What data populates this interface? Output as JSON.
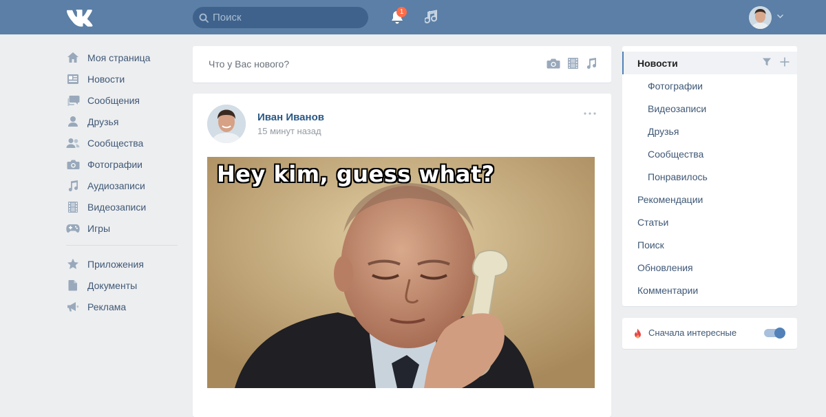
{
  "header": {
    "logo": "vk-logo-icon",
    "search_placeholder": "Поиск",
    "notifications_count": "1",
    "colors": {
      "bar": "#5b7fa6",
      "search": "#3f628c",
      "badge": "#ff6c48"
    }
  },
  "leftnav": {
    "items": [
      {
        "label": "Моя страница",
        "icon": "home-icon"
      },
      {
        "label": "Новости",
        "icon": "news-icon"
      },
      {
        "label": "Сообщения",
        "icon": "messages-icon"
      },
      {
        "label": "Друзья",
        "icon": "friend-icon"
      },
      {
        "label": "Сообщества",
        "icon": "communities-icon"
      },
      {
        "label": "Фотографии",
        "icon": "camera-icon"
      },
      {
        "label": "Аудиозаписи",
        "icon": "music-note-icon"
      },
      {
        "label": "Видеозаписи",
        "icon": "film-icon"
      },
      {
        "label": "Игры",
        "icon": "gamepad-icon"
      }
    ],
    "secondary": [
      {
        "label": "Приложения",
        "icon": "star-icon"
      },
      {
        "label": "Документы",
        "icon": "document-icon"
      },
      {
        "label": "Реклама",
        "icon": "megaphone-icon"
      }
    ]
  },
  "composer": {
    "placeholder": "Что у Вас нового?"
  },
  "post": {
    "author": "Иван Иванов",
    "time": "15 минут назад",
    "image_caption": "Hey kim, guess what?"
  },
  "rightmenu": {
    "items": [
      {
        "label": "Новости",
        "level": "top",
        "active": true
      },
      {
        "label": "Фотографии",
        "level": "sub"
      },
      {
        "label": "Видеозаписи",
        "level": "sub"
      },
      {
        "label": "Друзья",
        "level": "sub"
      },
      {
        "label": "Сообщества",
        "level": "sub"
      },
      {
        "label": "Понравилось",
        "level": "sub"
      },
      {
        "label": "Рекомендации",
        "level": "top"
      },
      {
        "label": "Статьи",
        "level": "top"
      },
      {
        "label": "Поиск",
        "level": "top"
      },
      {
        "label": "Обновления",
        "level": "top"
      },
      {
        "label": "Комментарии",
        "level": "top"
      }
    ],
    "accent": "#5181b8"
  },
  "interesting_toggle": {
    "label": "Сначала интересные",
    "on": true
  }
}
